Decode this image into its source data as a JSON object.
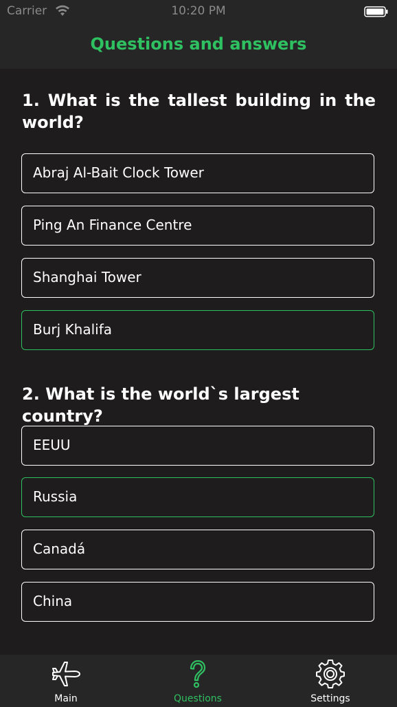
{
  "status_bar": {
    "carrier": "Carrier",
    "time": "10:20 PM",
    "wifi_icon": "wifi-icon",
    "battery_icon": "battery-icon"
  },
  "nav": {
    "title": "Questions and answers"
  },
  "colors": {
    "accent": "#2fc061",
    "background": "#1e1c1d",
    "bar_background": "#262626",
    "text": "#ffffff"
  },
  "questions": [
    {
      "text": "1. What is the tallest building in the world?",
      "answers": [
        {
          "label": "Abraj Al-Bait Clock Tower",
          "highlighted": false
        },
        {
          "label": "Ping An Finance Centre",
          "highlighted": false
        },
        {
          "label": "Shanghai Tower",
          "highlighted": false
        },
        {
          "label": "Burj Khalifa",
          "highlighted": true
        }
      ]
    },
    {
      "text": "2. What is the world`s largest country?",
      "answers": [
        {
          "label": "EEUU",
          "highlighted": false
        },
        {
          "label": "Russia",
          "highlighted": true
        },
        {
          "label": "Canadá",
          "highlighted": false
        },
        {
          "label": "China",
          "highlighted": false
        }
      ]
    }
  ],
  "tabs": [
    {
      "label": "Main",
      "icon": "airplane-icon",
      "active": false
    },
    {
      "label": "Questions",
      "icon": "question-icon",
      "active": true
    },
    {
      "label": "Settings",
      "icon": "gear-icon",
      "active": false
    }
  ]
}
